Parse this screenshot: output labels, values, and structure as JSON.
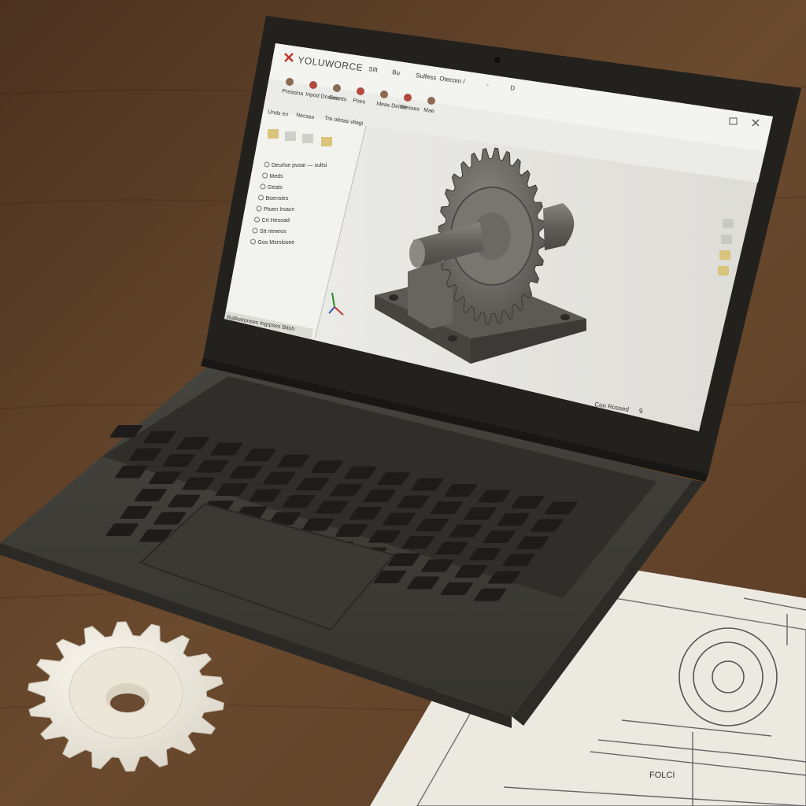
{
  "app": {
    "logo": "YOLUWORCE",
    "menu": [
      "Sift",
      "Bu",
      "Sulfess",
      "Otecom",
      "/",
      "-",
      "D"
    ],
    "ribbon": [
      {
        "label": "Pressina",
        "icon": "cube-feature-icon"
      },
      {
        "label": "Inpod Dnsses",
        "icon": "extrude-icon"
      },
      {
        "label": "Eoretts",
        "icon": "revolve-icon"
      },
      {
        "label": "Poes",
        "icon": "sweep-icon"
      },
      {
        "label": "Ideas Deiste",
        "icon": "loft-icon"
      },
      {
        "label": "Wesses",
        "icon": "fillet-icon"
      },
      {
        "label": "Mae",
        "icon": "pattern-icon"
      }
    ],
    "tabs": [
      "Unds en",
      "Necsso",
      "Tre ofetas vtiagi"
    ],
    "tree_items": [
      "Deurlse pvoar — sultsi",
      "Meds",
      "Geats",
      "Boensies",
      "Ptuen Irsacn",
      "Crt Hesoad",
      "Stt ntmeos",
      "Gos Msrslosee"
    ],
    "panel_footer": "Rafkeitonses Ingrpses Bitoh",
    "status": "Con Rossed",
    "status_value": "9"
  },
  "scene": {
    "accent_colors": {
      "desk": "#5a3f28",
      "laptop_body": "#3e3d38",
      "screen_bg": "#e6e6e2",
      "gear_model": "#6e6d68",
      "printed_gear": "#f1ece2",
      "paper": "#ece9e1"
    },
    "drawing_label": "FOLCI"
  }
}
